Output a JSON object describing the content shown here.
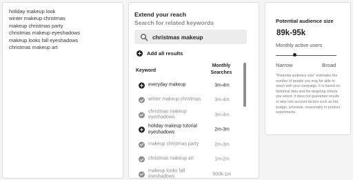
{
  "keyword_input": {
    "keywords": [
      "holiday makeup look",
      "winter makeup christmas",
      "makeup christmas party",
      "christmas makeup eyeshadows",
      "makeup looks fall eyeshadows",
      "christmas makeup art"
    ]
  },
  "search_panel": {
    "title": "Extend your reach",
    "subtitle": "Search for related keywords",
    "search_value": "christmas makeup",
    "add_all_label": "Add all results",
    "headers": {
      "keyword": "Keyword",
      "monthly_searches": "Monthly Searches"
    },
    "rows": [
      {
        "keyword": "everyday makeup",
        "volume": "3m-4m",
        "added": false
      },
      {
        "keyword": "winter makeup christmas",
        "volume": "3m-4m",
        "added": true
      },
      {
        "keyword": "christmas makeup eyeshadows",
        "volume": "3m-4m",
        "added": true
      },
      {
        "keyword": "holiday makeup tutorial eyeshadows",
        "volume": "2m-3m",
        "added": false
      },
      {
        "keyword": "makeup christmas party",
        "volume": "2m-3m",
        "added": true
      },
      {
        "keyword": "christmas makeup art",
        "volume": "1m-2m",
        "added": true
      },
      {
        "keyword": "makeup looks fall eyeshadows",
        "volume": "500k-1m",
        "added": true
      }
    ]
  },
  "audience": {
    "title": "Potential audience size",
    "value": "89k-95k",
    "subtitle": "Monthly active users",
    "narrow_label": "Narrow",
    "broad_label": "Broad",
    "slider_level": 0.31,
    "note": "\"Potential audience size\" estimates the number of people you may be able to reach with your campaign. It is based on historical data and the targeting criteria you select. It does not guarantee results or take into account factors such as bid, budget, schedule, seasonality or product experiments."
  },
  "icons": {
    "search": "magnifier-icon",
    "add": "plus-circle-icon",
    "added": "check-circle-icon"
  },
  "colors": {
    "added_gray": "#8d8d8d",
    "search_bg": "#ececec"
  }
}
